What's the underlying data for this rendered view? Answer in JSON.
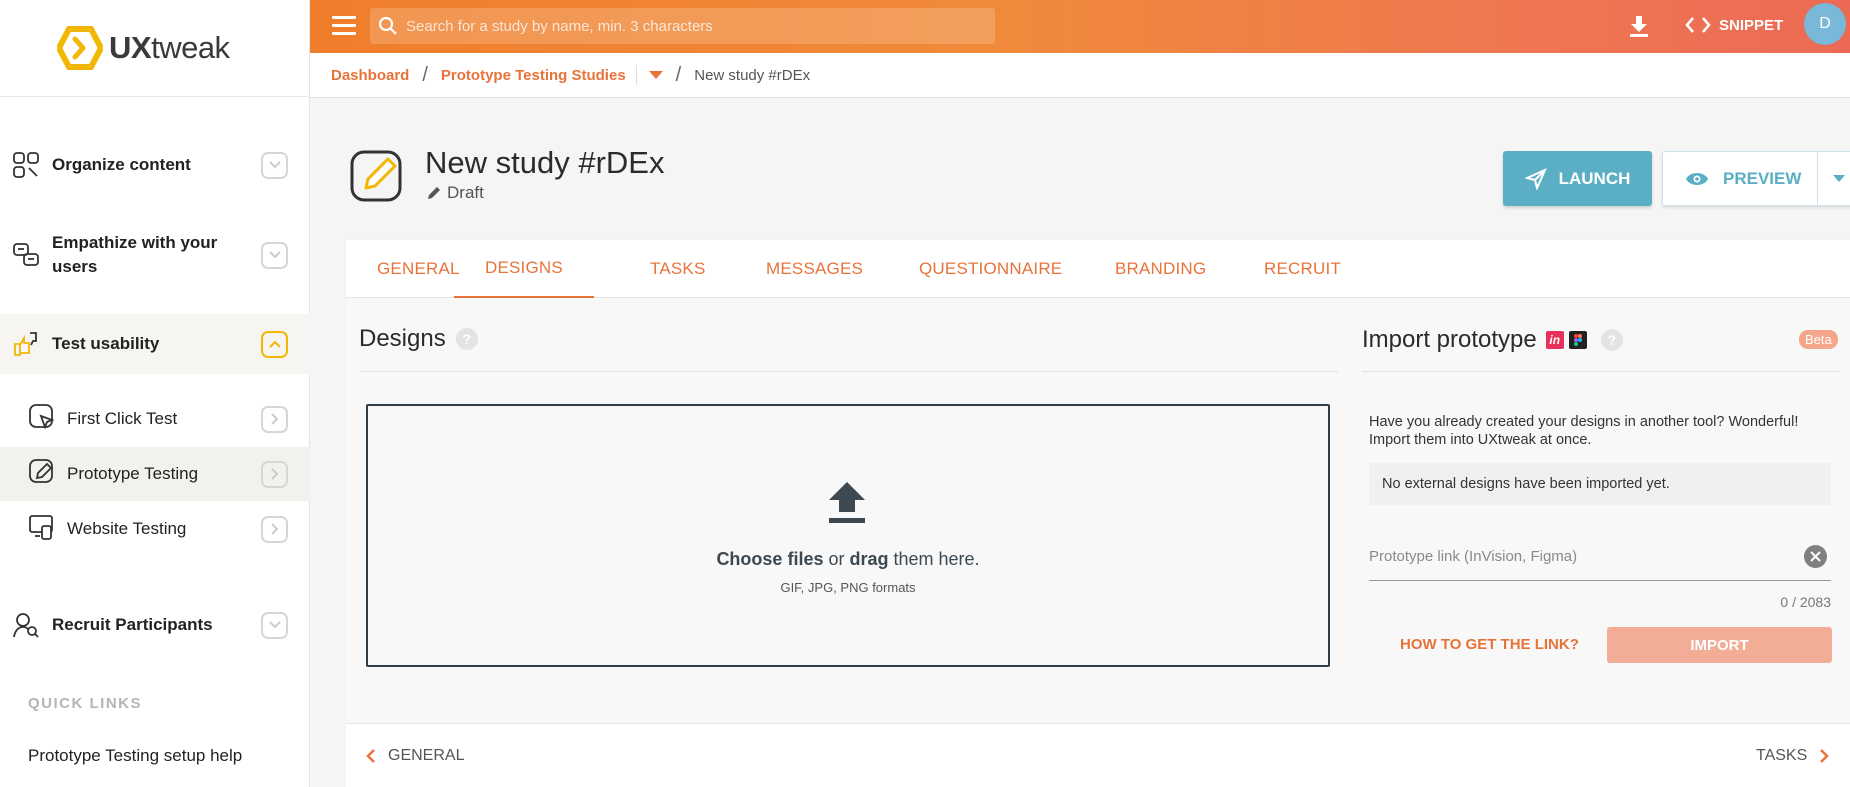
{
  "app": {
    "name_light": "UX",
    "name_rest": "tweak"
  },
  "search": {
    "placeholder": "Search for a study by name, min. 3 characters"
  },
  "topbar": {
    "snippet_label": "SNIPPET",
    "avatar_initial": "D"
  },
  "breadcrumb": {
    "dashboard": "Dashboard",
    "section": "Prototype Testing Studies",
    "current": "New study #rDEx"
  },
  "sidebar": {
    "sections": [
      {
        "label": "Organize content"
      },
      {
        "label": "Empathize with your users"
      },
      {
        "label": "Test usability"
      },
      {
        "label": "Recruit Participants"
      }
    ],
    "sub_items": [
      {
        "label": "First Click Test"
      },
      {
        "label": "Prototype Testing"
      },
      {
        "label": "Website Testing"
      }
    ],
    "quick_links_title": "QUICK LINKS",
    "quick_link": "Prototype Testing setup help"
  },
  "study": {
    "title": "New study #rDEx",
    "status": "Draft"
  },
  "actions": {
    "launch": "LAUNCH",
    "preview": "PREVIEW"
  },
  "tabs": [
    "GENERAL",
    "DESIGNS",
    "TASKS",
    "MESSAGES",
    "QUESTIONNAIRE",
    "BRANDING",
    "RECRUIT"
  ],
  "designs": {
    "title": "Designs",
    "choose": "Choose files",
    "or": " or ",
    "drag": "drag",
    "rest": " them here.",
    "formats": "GIF, JPG, PNG formats"
  },
  "import": {
    "title": "Import prototype",
    "beta": "Beta",
    "description": "Have you already created your designs in another tool? Wonderful! Import them into UXtweak at once.",
    "no_external": "No external designs have been imported yet.",
    "input_placeholder": "Prototype link (InVision, Figma)",
    "counter": "0 / 2083",
    "how_link": "HOW TO GET THE LINK?",
    "import_button": "IMPORT"
  },
  "footer": {
    "prev": "GENERAL",
    "next": "TASKS"
  },
  "colors": {
    "accent": "#e8733a",
    "launch": "#5bafc4",
    "logo": "#f2b705"
  }
}
